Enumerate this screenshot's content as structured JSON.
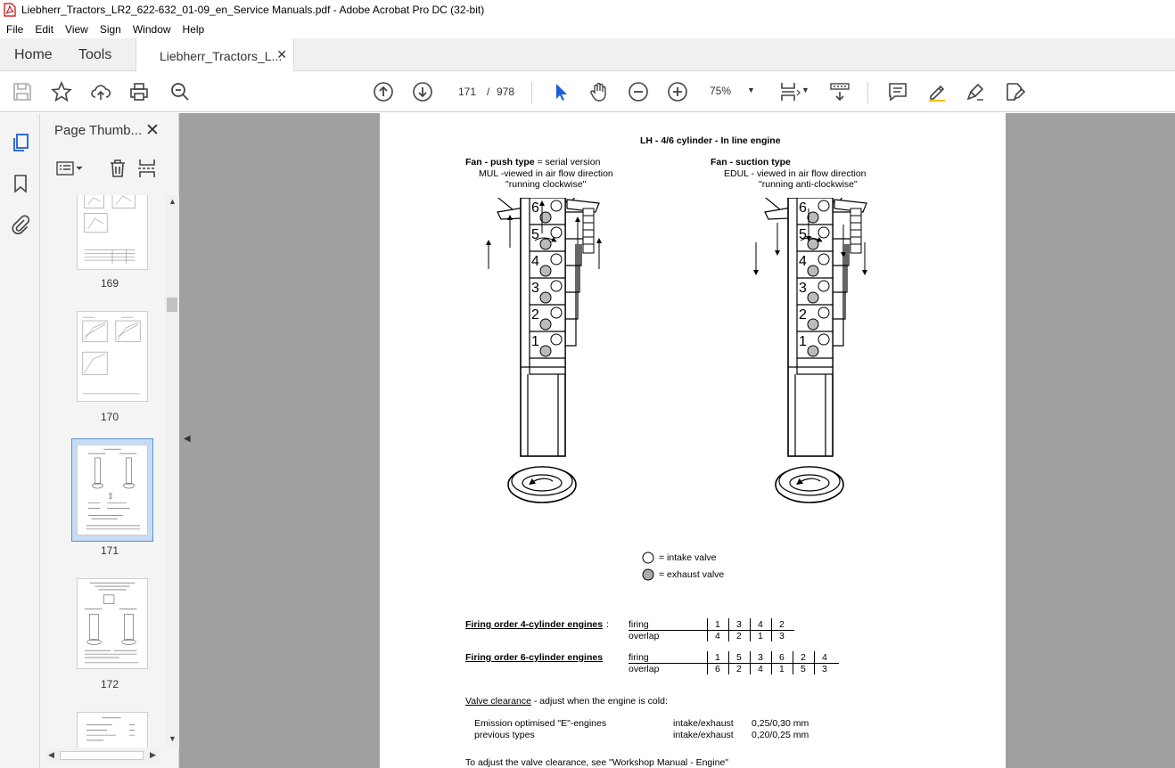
{
  "window": {
    "title": "Liebherr_Tractors_LR2_622-632_01-09_en_Service Manuals.pdf - Adobe Acrobat Pro DC (32-bit)"
  },
  "menu": [
    "File",
    "Edit",
    "View",
    "Sign",
    "Window",
    "Help"
  ],
  "tabs": {
    "home": "Home",
    "tools": "Tools",
    "document": "Liebherr_Tractors_L...",
    "close": "✕"
  },
  "toolbar": {
    "current_page": "171",
    "separator": "/",
    "total_pages": "978",
    "zoom": "75%"
  },
  "sidepanel": {
    "title": "Page Thumb...",
    "close": "✕",
    "thumbnails": [
      {
        "page": "169",
        "selected": false
      },
      {
        "page": "170",
        "selected": false
      },
      {
        "page": "171",
        "selected": true
      },
      {
        "page": "172",
        "selected": false
      }
    ]
  },
  "pdf": {
    "heading": "LH - 4/6 cylinder - In line engine",
    "left": {
      "line1_bold": "Fan - push type",
      "line1_rest": " = serial version",
      "line2": "MUL -viewed in air flow direction",
      "line3": "\"running clockwise\""
    },
    "right": {
      "line1_bold": "Fan - suction type",
      "line2": "EDUL - viewed in air flow direction",
      "line3": "\"running anti-clockwise\""
    },
    "cylinders": [
      "6",
      "5",
      "4",
      "3",
      "2",
      "1"
    ],
    "legend": {
      "intake": "= intake valve",
      "exhaust": "= exhaust valve"
    },
    "firing4": {
      "label": "Firing order 4-cylinder engines",
      "colon": ":",
      "row1_label": "firing",
      "row1": [
        "1",
        "3",
        "4",
        "2"
      ],
      "row2_label": "overlap",
      "row2": [
        "4",
        "2",
        "1",
        "3"
      ]
    },
    "firing6": {
      "label": "Firing order 6-cylinder engines",
      "row1_label": "firing",
      "row1": [
        "1",
        "5",
        "3",
        "6",
        "2",
        "4"
      ],
      "row2_label": "overlap",
      "row2": [
        "6",
        "2",
        "4",
        "1",
        "5",
        "3"
      ]
    },
    "clearance": {
      "label": "Valve clearance",
      "rest": " - adjust when the engine is cold:",
      "rows": [
        {
          "name": "Emission optimised \"E\"-engines",
          "type": "intake/exhaust",
          "value": "0,25/0,30 mm"
        },
        {
          "name": "previous types",
          "type": "intake/exhaust",
          "value": "0,20/0,25 mm"
        }
      ],
      "footer": "To adjust the valve clearance, see \"Workshop Manual - Engine\""
    }
  }
}
